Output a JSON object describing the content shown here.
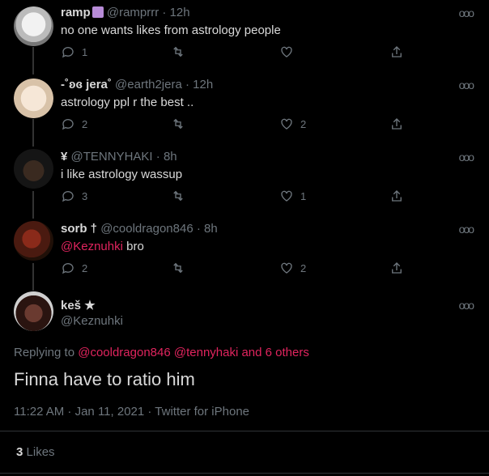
{
  "tweets": [
    {
      "name": "ramp",
      "handle": "@ramprrr",
      "time": "12h",
      "text": "no one wants likes from astrology people",
      "reply_count": "1",
      "retweet_count": "",
      "like_count": ""
    },
    {
      "name": "-˚ʚɞ jera˚",
      "handle": "@earth2jera",
      "time": "12h",
      "text": "astrology ppl r the best ..",
      "reply_count": "2",
      "retweet_count": "",
      "like_count": "2"
    },
    {
      "name": "¥",
      "handle": "@TENNYHAKI",
      "time": "8h",
      "text": "i like astrology wassup",
      "reply_count": "3",
      "retweet_count": "",
      "like_count": "1"
    },
    {
      "name": "sorb †",
      "handle": "@cooldragon846",
      "time": "8h",
      "mention": "@Keznuhki",
      "text": " bro",
      "reply_count": "2",
      "retweet_count": "",
      "like_count": "2"
    }
  ],
  "main": {
    "name": "keš ★",
    "handle": "@Keznuhki",
    "replying_label": "Replying to",
    "replying_mentions": "@cooldragon846 @tennyhaki and 6 others",
    "text": "Finna have to ratio him",
    "meta": "11:22 AM · Jan 11, 2021 · Twitter for iPhone",
    "likes_count": "3",
    "likes_label": "Likes"
  },
  "colors": {
    "background": "#000000",
    "text": "#d9d9d9",
    "muted": "#6e767d",
    "accent": "#e0245e"
  },
  "icons": [
    "reply-icon",
    "retweet-icon",
    "like-icon",
    "share-icon",
    "more-icon"
  ],
  "sep": " · ",
  "more_glyph": "ooo"
}
